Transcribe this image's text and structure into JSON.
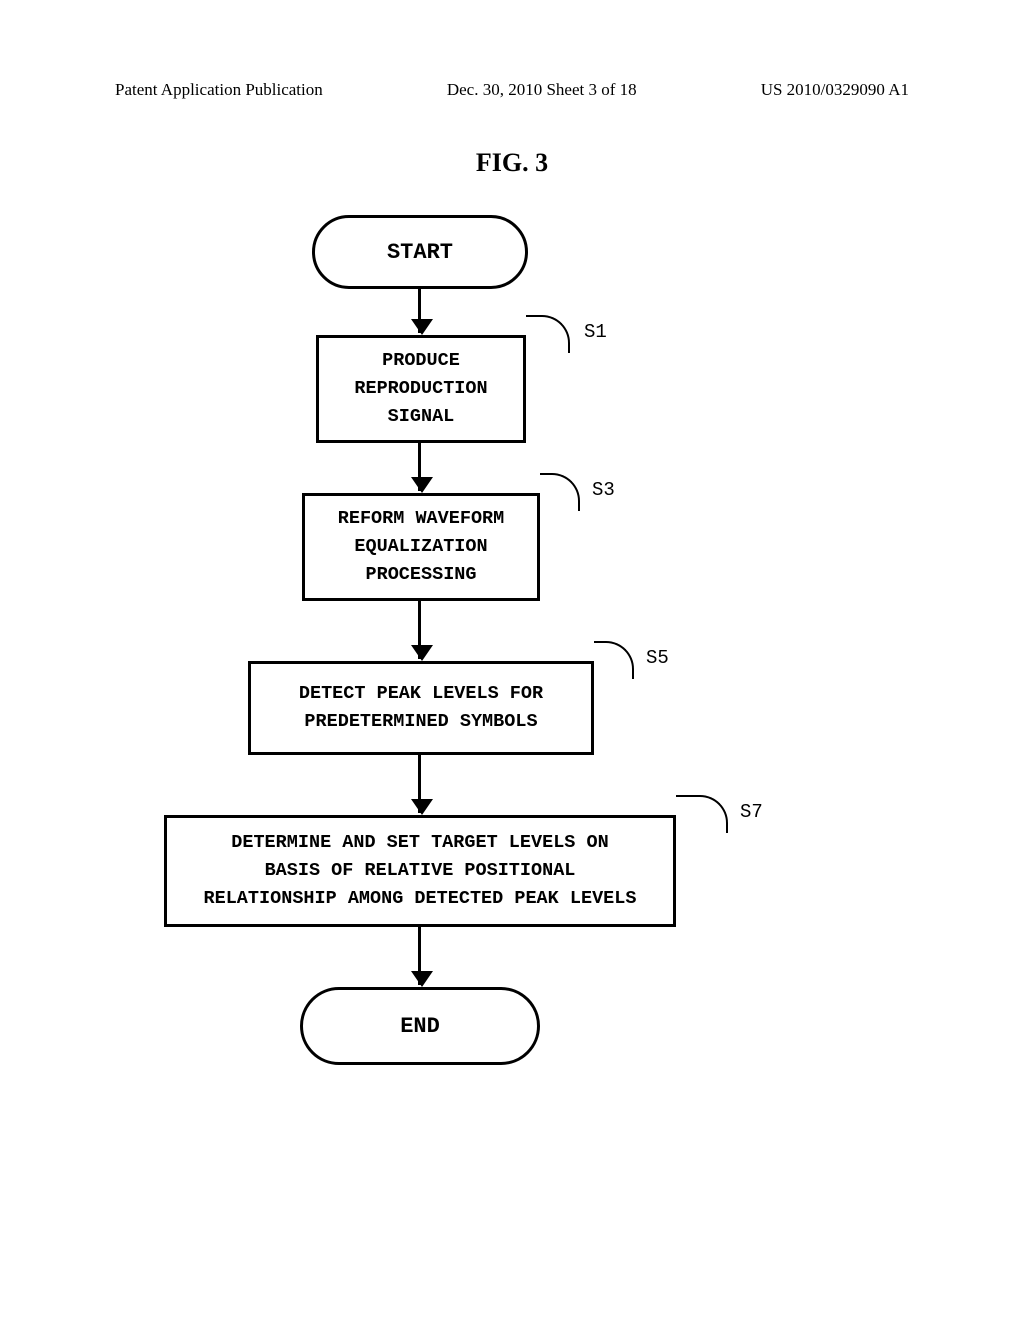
{
  "header": {
    "left": "Patent Application Publication",
    "center": "Dec. 30, 2010  Sheet 3 of 18",
    "right": "US 2010/0329090 A1"
  },
  "figure": {
    "title": "FIG. 3"
  },
  "flow": {
    "start": "START",
    "end": "END",
    "s1_label": "S1",
    "s1_text": "PRODUCE\nREPRODUCTION\nSIGNAL",
    "s3_label": "S3",
    "s3_text": "REFORM WAVEFORM\nEQUALIZATION\nPROCESSING",
    "s5_label": "S5",
    "s5_text": "DETECT PEAK LEVELS FOR\nPREDETERMINED SYMBOLS",
    "s7_label": "S7",
    "s7_text": "DETERMINE AND SET TARGET LEVELS ON\nBASIS OF RELATIVE POSITIONAL\nRELATIONSHIP AMONG DETECTED PEAK LEVELS"
  }
}
